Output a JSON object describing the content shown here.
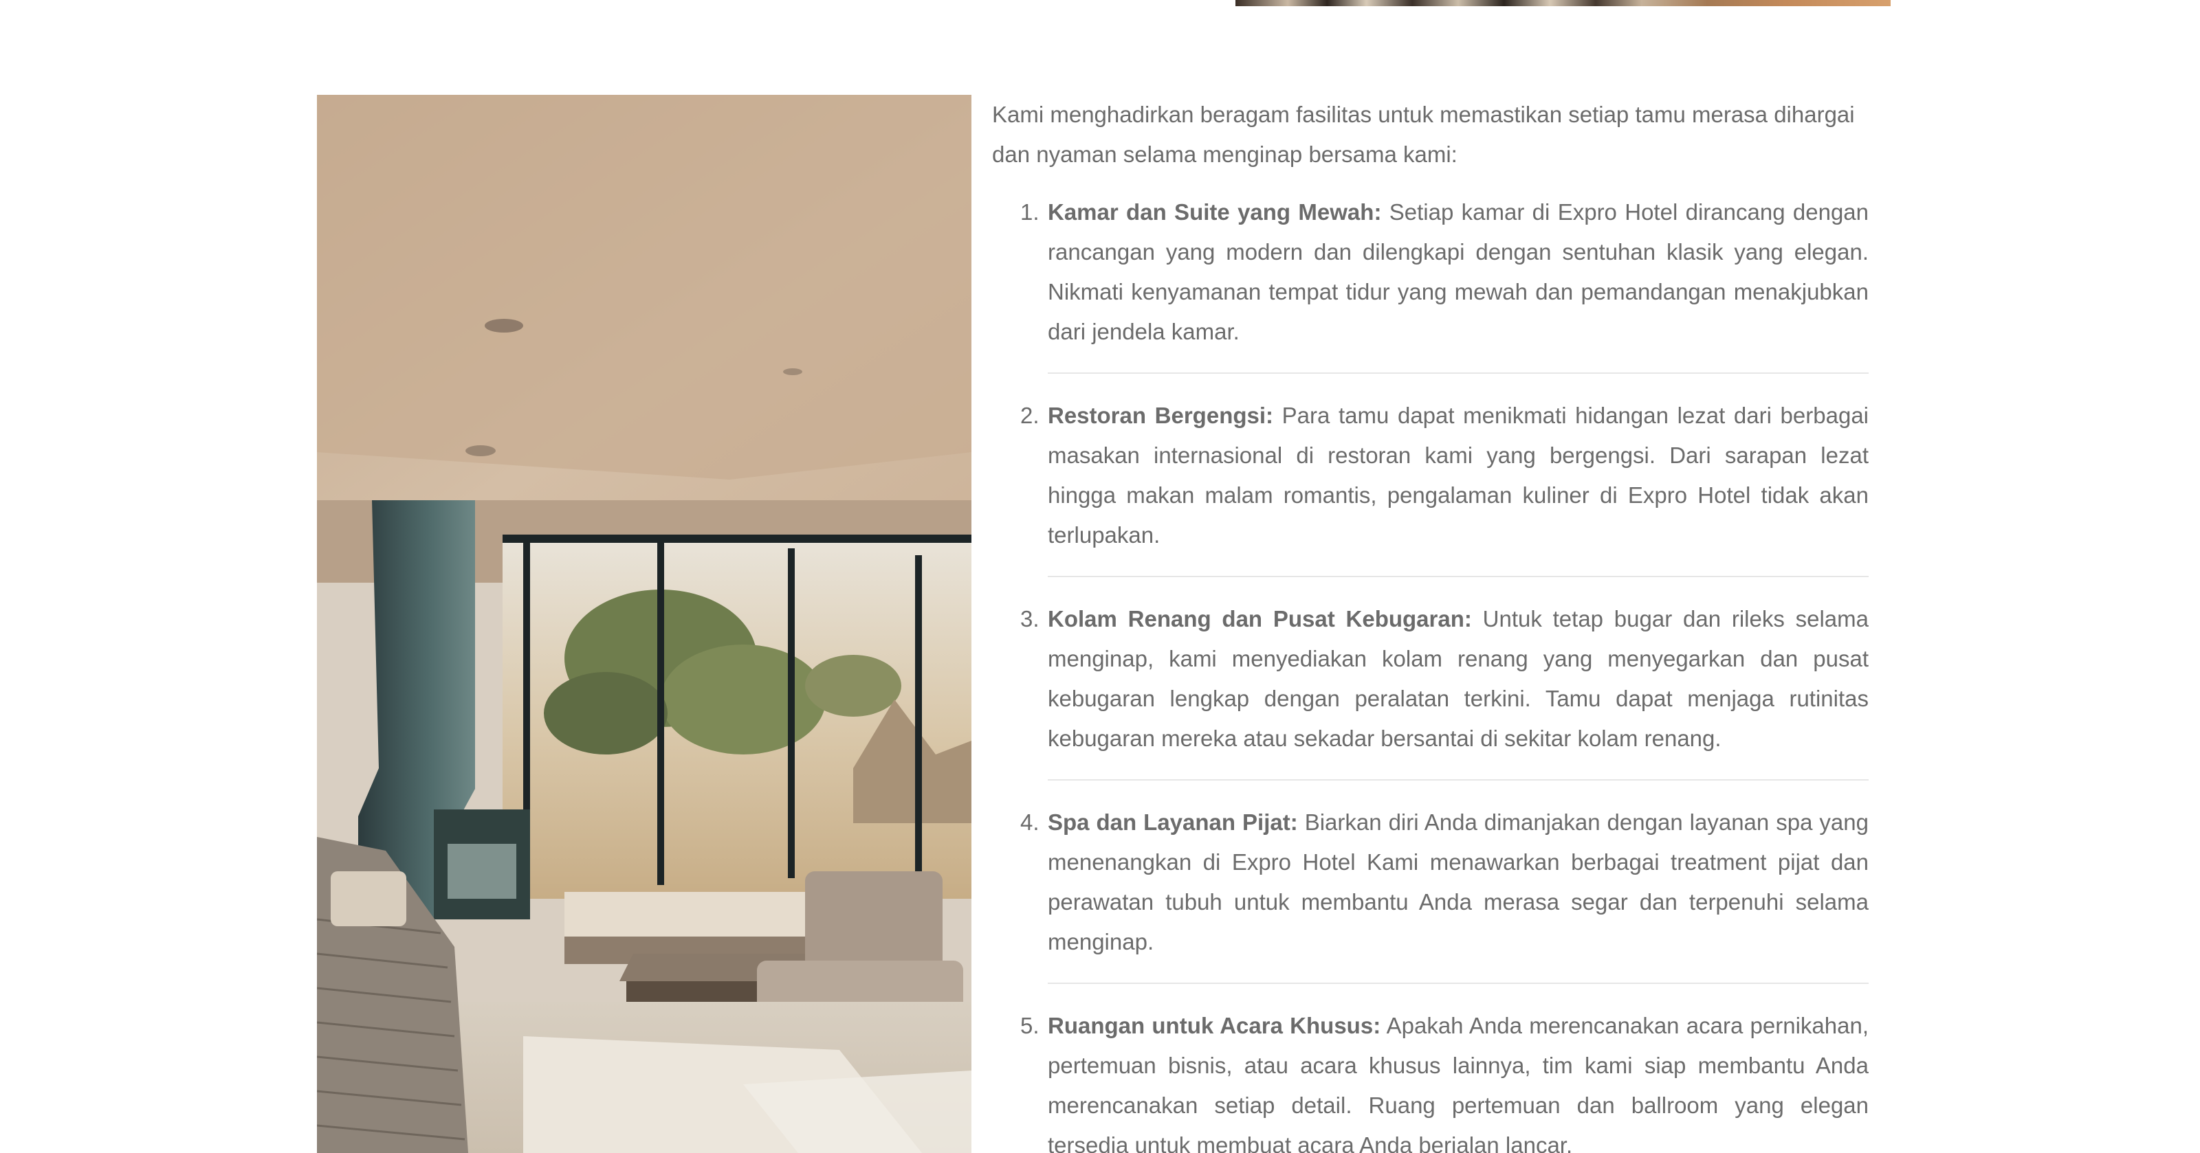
{
  "intro": "Kami menghadirkan beragam fasilitas untuk memastikan setiap tamu merasa dihargai dan nyaman selama menginap bersama kami:",
  "facilities": [
    {
      "number": "1.",
      "title": "Kamar dan Suite yang Mewah:",
      "text": " Setiap kamar di Expro Hotel dirancang dengan rancangan yang modern dan dilengkapi dengan sentuhan klasik yang elegan. Nikmati kenyamanan tempat tidur yang mewah dan pemandangan menakjubkan dari jendela kamar."
    },
    {
      "number": "2.",
      "title": "Restoran Bergengsi:",
      "text": " Para tamu dapat menikmati hidangan lezat dari berbagai masakan internasional di restoran kami yang bergengsi. Dari sarapan lezat hingga makan malam romantis, pengalaman kuliner di Expro Hotel tidak akan terlupakan."
    },
    {
      "number": "3.",
      "title": "Kolam Renang dan Pusat Kebugaran:",
      "text": " Untuk tetap bugar dan rileks selama menginap, kami menyediakan kolam renang yang menyegarkan dan pusat kebugaran lengkap dengan peralatan terkini. Tamu dapat menjaga rutinitas kebugaran mereka atau sekadar bersantai di sekitar kolam renang."
    },
    {
      "number": "4.",
      "title": "Spa dan Layanan Pijat:",
      "text": " Biarkan diri Anda dimanjakan dengan layanan spa yang menenangkan di Expro Hotel Kami menawarkan berbagai treatment pijat dan perawatan tubuh untuk membantu Anda merasa segar dan terpenuhi selama menginap."
    },
    {
      "number": "5.",
      "title": "Ruangan untuk Acara Khusus:",
      "text": " Apakah Anda merencanakan acara pernikahan, pertemuan bisnis, atau acara khusus lainnya, tim kami siap membantu Anda merencanakan setiap detail. Ruang pertemuan dan ballroom yang elegan tersedia untuk membuat acara Anda berjalan lancar."
    }
  ]
}
